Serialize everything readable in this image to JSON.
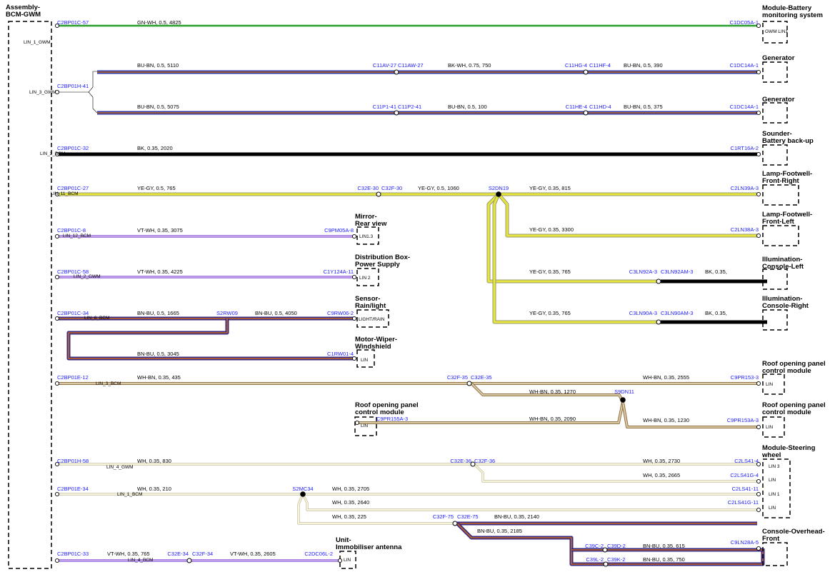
{
  "title_left": [
    "Assembly-",
    "BCM-GWM"
  ],
  "colors": {
    "GN-WH": "#2ca02c",
    "BU-BN": "#2e3aa8",
    "BU-BN-stripe": "#c46a1a",
    "BK-WH": "#111111",
    "BK": "#000000",
    "YE-GY": "#e6e63a",
    "YE-GY-edge": "#9a9a7a",
    "VT-WH": "#7a3fd0",
    "BN-BU": "#3a2a88",
    "BN-BU-stripe": "#c46a1a",
    "WH-BN": "#d8c9a6",
    "WH-BN-edge": "#8c6a3a",
    "WH": "#f6f3d6",
    "WH-edge": "#b9b39a",
    "connector": "#1a1aff"
  },
  "left_pins": [
    "LIN_1_GWM",
    "LIN_3_GWM",
    "LIN_2_BCM",
    "LIN_11_BCM",
    "LIN_12_BCM",
    "LIN_2_GWM",
    "LIN_6_BCM",
    "LIN_3_BCM",
    "LIN_4_GWM",
    "LIN_1_BCM",
    "LIN_4_BCM"
  ],
  "components": [
    {
      "id": "battery",
      "name": [
        "Module-Battery",
        "monitoring system"
      ],
      "pins": [
        "GWM LIN1"
      ]
    },
    {
      "id": "gen1",
      "name": [
        "Generator"
      ],
      "pins": []
    },
    {
      "id": "gen2",
      "name": [
        "Generator"
      ],
      "pins": []
    },
    {
      "id": "sounder",
      "name": [
        "Sounder-",
        "Battery back-up"
      ],
      "pins": []
    },
    {
      "id": "lampfr",
      "name": [
        "Lamp-Footwell-",
        "Front-Right"
      ],
      "pins": []
    },
    {
      "id": "lampfl",
      "name": [
        "Lamp-Footwell-",
        "Front-Left"
      ],
      "pins": []
    },
    {
      "id": "illl",
      "name": [
        "Illumination-",
        "Console-Left"
      ],
      "pins": []
    },
    {
      "id": "illr",
      "name": [
        "Illumination-",
        "Console-Right"
      ],
      "pins": []
    },
    {
      "id": "mirror",
      "name": [
        "Mirror-",
        "Rear view"
      ],
      "pins": [
        "LIN1.3"
      ]
    },
    {
      "id": "distbox",
      "name": [
        "Distribution Box-",
        "Power Supply"
      ],
      "pins": [
        "LIN 2"
      ]
    },
    {
      "id": "sensor",
      "name": [
        "Sensor-",
        "Rain/light"
      ],
      "pins": [
        "LIGHT/RAIN"
      ]
    },
    {
      "id": "wiper",
      "name": [
        "Motor-Wiper-",
        "Windshield"
      ],
      "pins": [
        "LIN"
      ]
    },
    {
      "id": "roof1",
      "name": [
        "Roof opening panel",
        "control module"
      ],
      "pins": [
        "LIN"
      ]
    },
    {
      "id": "roofmid",
      "name": [
        "Roof opening panel",
        "control module"
      ],
      "pins": [
        "LIN"
      ]
    },
    {
      "id": "roof2",
      "name": [
        "Roof opening panel",
        "control module"
      ],
      "pins": [
        "LIN"
      ]
    },
    {
      "id": "steer",
      "name": [
        "Module-Steering",
        "wheel"
      ],
      "pins": [
        "LIN 3",
        "LIN",
        "LIN 1",
        "LIN"
      ]
    },
    {
      "id": "overhead",
      "name": [
        "Console-Overhead-",
        "Front"
      ],
      "pins": []
    },
    {
      "id": "immob",
      "name": [
        "Unit-",
        "Immobiliser antenna"
      ],
      "pins": [
        "LIN"
      ]
    }
  ],
  "connectors": [
    "C2BP01C-57",
    "C1DC05A-1",
    "C2BP01H-41",
    "C11AV-27",
    "C11AW-27",
    "C11HG-4",
    "C11HF-4",
    "C1DC14A-1",
    "C11P1-41",
    "C11P2-41",
    "C11HE-4",
    "C11HD-4",
    "C1DC14A-1",
    "C2BP01C-32",
    "C1RT16A-2",
    "C2BP01C-27",
    "C32E-30",
    "C32F-30",
    "S2DN19",
    "C2LN39A-3",
    "C2LN38A-3",
    "C3LN92A-3",
    "C3LN92AM-3",
    "C3LN90A-3",
    "C3LN90AM-3",
    "C2BP01C-8",
    "C9PM05A-8",
    "C2BP01C-58",
    "C1Y124A-11",
    "C2BP01C-34",
    "S2RW09",
    "C9RW06-2",
    "C1RW01-4",
    "C2BP01E-12",
    "C32F-35",
    "C32E-35",
    "C9PR153-3",
    "S9DN11",
    "C9PR155A-3",
    "C9PR153A-3",
    "C2BP01H-58",
    "C32E-36",
    "C32F-36",
    "C2LS41-4",
    "C2LS41G-4",
    "C2BP01E-34",
    "S2MC34",
    "C2LS41-11",
    "C2LS41G-11",
    "C32F-75",
    "C32E-75",
    "C39C-2",
    "C39D-2",
    "C9LN28A-5",
    "C39L-2",
    "C39K-2",
    "C2BP01C-33",
    "C32E-34",
    "C32F-34",
    "C2DC06L-2"
  ],
  "wire_labels": [
    "GN-WH, 0.5, 4825",
    "BU-BN, 0.5, 5110",
    "BK-WH, 0.75, 750",
    "BU-BN, 0.5, 390",
    "BU-BN, 0.5, 5075",
    "BU-BN, 0.5, 100",
    "BU-BN, 0.5, 375",
    "BK, 0.35, 2020",
    "YE-GY, 0.5, 765",
    "YE-GY, 0.5, 1060",
    "YE-GY, 0.35, 815",
    "YE-GY, 0.35, 3300",
    "YE-GY, 0.35, 765",
    "BK, 0.35,",
    "YE-GY, 0.35, 765",
    "BK, 0.35,",
    "VT-WH, 0.35, 3075",
    "VT-WH, 0.35, 4225",
    "BN-BU, 0.5, 1665",
    "BN-BU, 0.5, 4050",
    "BN-BU, 0.5, 3045",
    "WH-BN, 0.35, 435",
    "WH-BN, 0.35, 2555",
    "WH-BN, 0.35, 1270",
    "WH-BN, 0.35, 2090",
    "WH-BN, 0.35, 1230",
    "WH, 0.35, 830",
    "WH, 0.35, 2730",
    "WH, 0.35, 2665",
    "WH, 0.35, 210",
    "WH, 0.35, 2705",
    "WH, 0.35, 2640",
    "WH, 0.35, 225",
    "BN-BU, 0.35, 2140",
    "BN-BU, 0.35, 2185",
    "BN-BU, 0.35, 615",
    "BN-BU, 0.35, 750",
    "VT-WH, 0.35, 765",
    "VT-WH, 0.35, 2605"
  ]
}
